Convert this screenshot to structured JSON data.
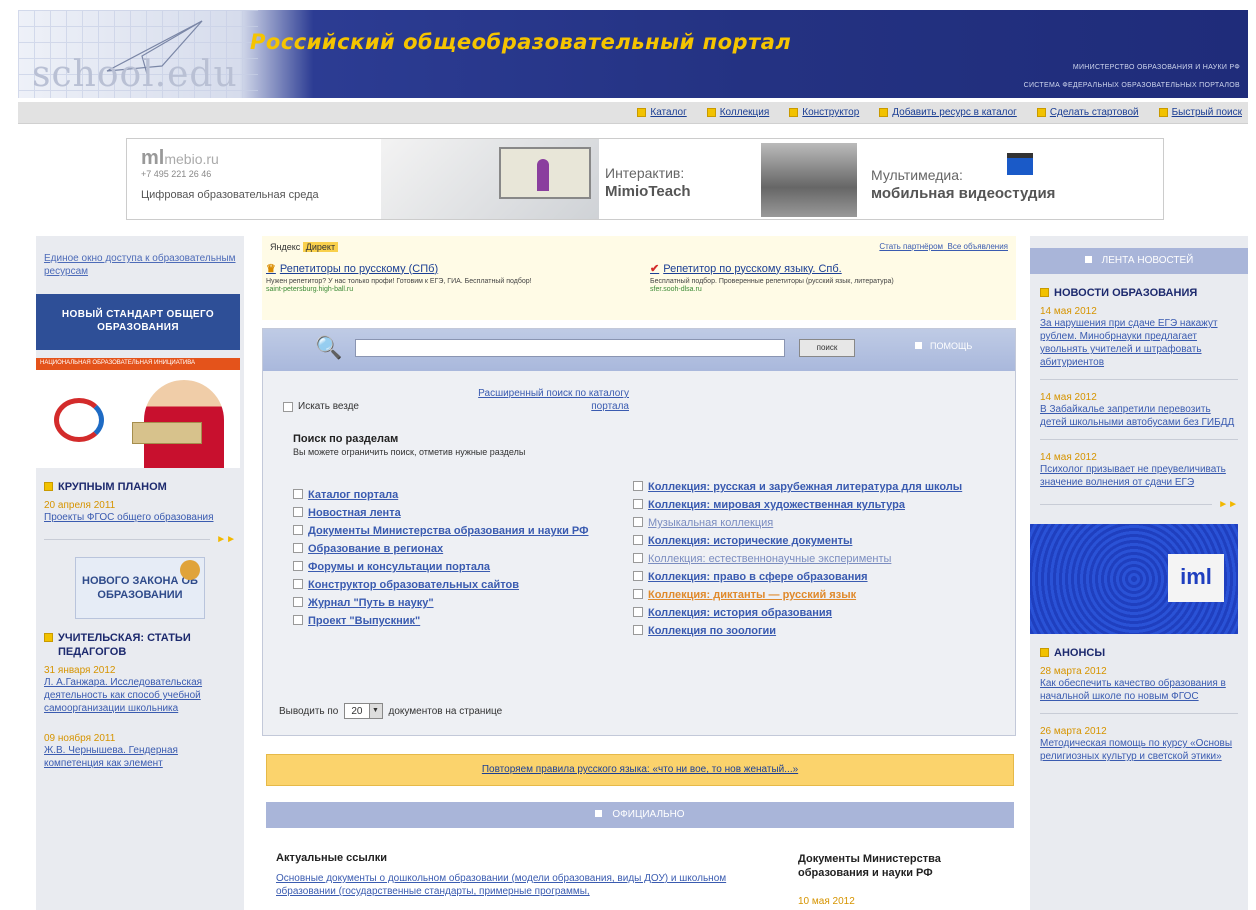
{
  "header": {
    "logo": "school.edu",
    "title": "Российский общеобразовательный портал",
    "ministry": "МИНИСТЕРСТВО ОБРАЗОВАНИЯ И НАУКИ РФ",
    "system": "СИСТЕМА ФЕДЕРАЛЬНЫХ ОБРАЗОВАТЕЛЬНЫХ ПОРТАЛОВ"
  },
  "topnav": [
    "Каталог",
    "Коллекция",
    "Конструктор",
    "Добавить ресурс в каталог",
    "Сделать стартовой",
    "Быстрый поиск"
  ],
  "banner": {
    "brand": "ml",
    "brand_suffix": "mebio.ru",
    "phone": "+7 495 221 26 46",
    "env": "Цифровая образовательная среда",
    "interactive_label": "Интерактив:",
    "interactive_name": "MimioTeach",
    "multimedia_label": "Мультимедиа:",
    "multimedia_name": "мобильная видеостудия"
  },
  "left": {
    "access": "Единое окно доступа к образовательным ресурсам",
    "standard": "НОВЫЙ СТАНДАРТ ОБЩЕГО ОБРАЗОВАНИЯ",
    "adv_bar": "НАЦИОНАЛЬНАЯ ОБРАЗОВАТЕЛЬНАЯ ИНИЦИАТИВА",
    "closeup_title": "КРУПНЫМ ПЛАНОМ",
    "closeup_date": "20 апреля 2011",
    "closeup_link": "Проекты ФГОС общего образования",
    "law": "НОВОГО ЗАКОНА ОБ ОБРАЗОВАНИИ",
    "teacher_title": "УЧИТЕЛЬСКАЯ: СТАТЬИ ПЕДАГОГОВ",
    "teacher_date1": "31 января 2012",
    "teacher_link1": "Л. А.Ганжара. Исследовательская деятельность как способ учебной самоорганизации школьника",
    "teacher_date2": "09 ноября 2011",
    "teacher_link2": "Ж.В. Чернышева. Гендерная компетенция как элемент"
  },
  "yandex": {
    "logo": "Яндекс",
    "direct": "Директ",
    "partner": "Стать партнёром",
    "all_ads": "Все объявления",
    "ad1_title": "Репетиторы по русскому (СПб)",
    "ad1_desc": "Нужен репетитор? У нас только профи! Готовим к ЕГЭ, ГИА. Бесплатный подбор!",
    "ad1_url": "saint-petersburg.high-ball.ru",
    "ad2_title": "Репетитор по русскому языку. Спб.",
    "ad2_desc": "Бесплатный подбор. Проверенные репетиторы (русский язык, литература)",
    "ad2_url": "sfer.sooh-dlsa.ru"
  },
  "search": {
    "input_value": "",
    "button": "поиск",
    "help": "ПОМОЩЬ",
    "advanced": "Расширенный поиск по каталогу портала",
    "inside": "Искать везде",
    "sections_title": "Поиск по разделам",
    "sections_sub": "Вы можете ограничить поиск, отметив нужные разделы",
    "left_sections": [
      "Каталог портала",
      "Новостная лента",
      "Документы Министерства образования и науки РФ",
      "Образование в регионах",
      "Форумы и консультации портала",
      "Конструктор образовательных сайтов",
      "Журнал \"Путь в науку\"",
      "Проект \"Выпускник\""
    ],
    "right_sections": [
      "Коллекция: русская и зарубежная литература для школы",
      "Коллекция: мировая художественная культура",
      "Музыкальная коллекция",
      "Коллекция: исторические документы",
      "Коллекция: естественнонаучные эксперименты",
      "Коллекция: право в сфере образования",
      "Коллекция: диктанты — русский язык",
      "Коллекция: история образования",
      "Коллекция по зоологии"
    ],
    "perpage_prefix": "Выводить по",
    "perpage_value": "20",
    "perpage_suffix": "документов на странице"
  },
  "rules_bar": "Повторяем правила русского языка: «что ни вое, то нов женатый...»",
  "official": "ОФИЦИАЛЬНО",
  "actual": {
    "title": "Актуальные ссылки",
    "link": "Основные документы о дошкольном образовании (модели образования, виды ДОУ) и школьном образовании (государственные стандарты, примерные программы,"
  },
  "docs": {
    "title": "Документы Министерства образования и науки РФ",
    "date": "10 мая 2012"
  },
  "right": {
    "feed": "ЛЕНТА НОВОСТЕЙ",
    "news_title": "НОВОСТИ ОБРАЗОВАНИЯ",
    "news": [
      {
        "date": "14 мая 2012",
        "text": "За нарушения при сдаче ЕГЭ накажут рублем. Минобрнауки предлагает увольнять учителей и штрафовать абитуриентов"
      },
      {
        "date": "14 мая 2012",
        "text": "В Забайкалье запретили перевозить детей школьными автобусами без ГИБДД"
      },
      {
        "date": "14 мая 2012",
        "text": "Психолог призывает не преувеличивать значение волнения от сдачи ЕГЭ"
      }
    ],
    "iml": "iml",
    "announce_title": "АНОНСЫ",
    "announces": [
      {
        "date": "28 марта 2012",
        "text": "Как обеспечить качество образования в начальной школе по новым ФГОС"
      },
      {
        "date": "26 марта 2012",
        "text": "Методическая помощь по курсу «Основы религиозных культур и светской этики»"
      }
    ]
  }
}
